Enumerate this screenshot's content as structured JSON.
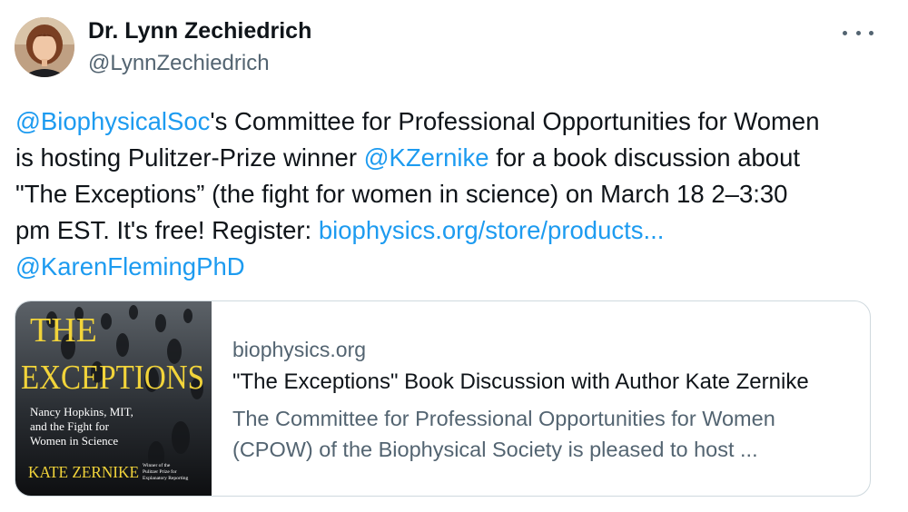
{
  "author": {
    "name": "Dr. Lynn Zechiedrich",
    "handle": "@LynnZechiedrich"
  },
  "more_icon": "ellipsis-icon",
  "tweet": {
    "mention_1": "@BiophysicalSoc",
    "text_1a": "'s Committee for Professional Opportunities for Women",
    "text_2a": "is hosting Pulitzer-Prize winner ",
    "mention_2": "@KZernike",
    "text_2b": " for a book discussion about",
    "text_3": "\"The Exceptions” (the fight for women in science) on March 18 2–3:30",
    "text_4a": "pm EST. It's free! Register: ",
    "link": "biophysics.org/store/products...",
    "mention_3": "@KarenFlemingPhD"
  },
  "card": {
    "domain": "biophysics.org",
    "title": "\"The Exceptions\" Book Discussion with Author Kate Zernike",
    "desc_line_1": "The Committee for Professional Opportunities for Women",
    "desc_line_2": "(CPOW) of the Biophysical Society is pleased to host ...",
    "book": {
      "title_1": "THE",
      "title_2": "EXCEPTIONS",
      "subtitle_1": "Nancy Hopkins, MIT,",
      "subtitle_2": "and the Fight for",
      "subtitle_3": "Women in Science",
      "author": "KATE ZERNIKE",
      "award_1": "Winner of the",
      "award_2": "Pulitzer Prize for",
      "award_3": "Explanatory Reporting"
    }
  },
  "colors": {
    "link": "#1d9bf0",
    "text": "#0f1419",
    "secondary": "#536471",
    "border": "#cfd9de",
    "book_yellow": "#f2d43a"
  }
}
